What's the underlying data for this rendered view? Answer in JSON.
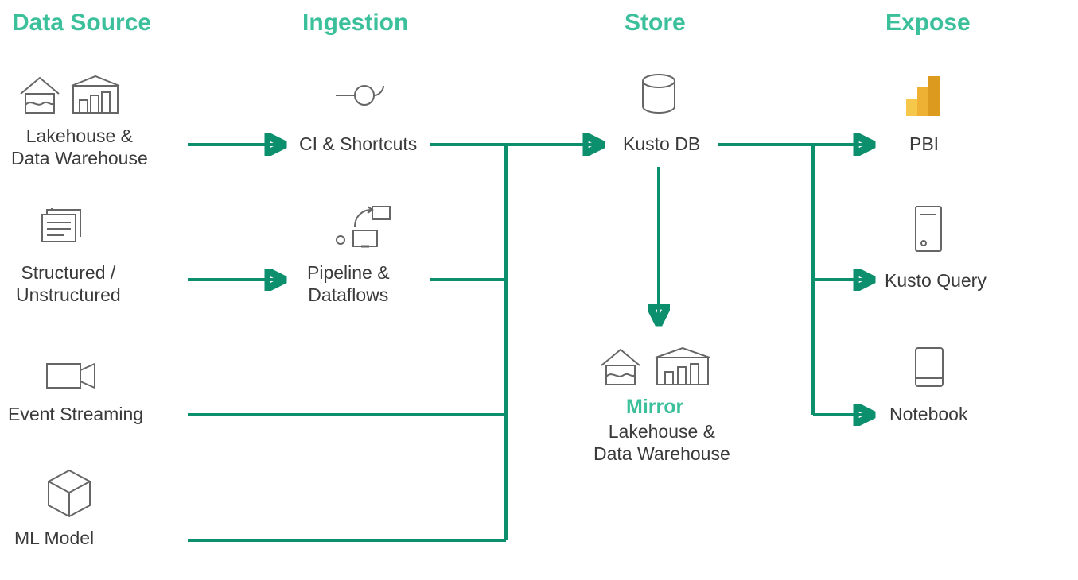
{
  "columns": {
    "data_source": "Data Source",
    "ingestion": "Ingestion",
    "store": "Store",
    "expose": "Expose"
  },
  "nodes": {
    "lakehouse_dw": "Lakehouse &\nData Warehouse",
    "structured_unstructured": "Structured /\nUnstructured",
    "event_streaming": "Event Streaming",
    "ml_model": "ML Model",
    "ci_shortcuts": "CI & Shortcuts",
    "pipeline_dataflows": "Pipeline &\nDataflows",
    "kusto_db": "Kusto DB",
    "mirror": "Mirror",
    "mirror_sub": "Lakehouse &\nData Warehouse",
    "pbi": "PBI",
    "kusto_query": "Kusto Query",
    "notebook": "Notebook"
  },
  "colors": {
    "accent": "#3cc09b",
    "connector": "#0b8f6d",
    "text": "#3a3a3a",
    "icon": "#666"
  }
}
